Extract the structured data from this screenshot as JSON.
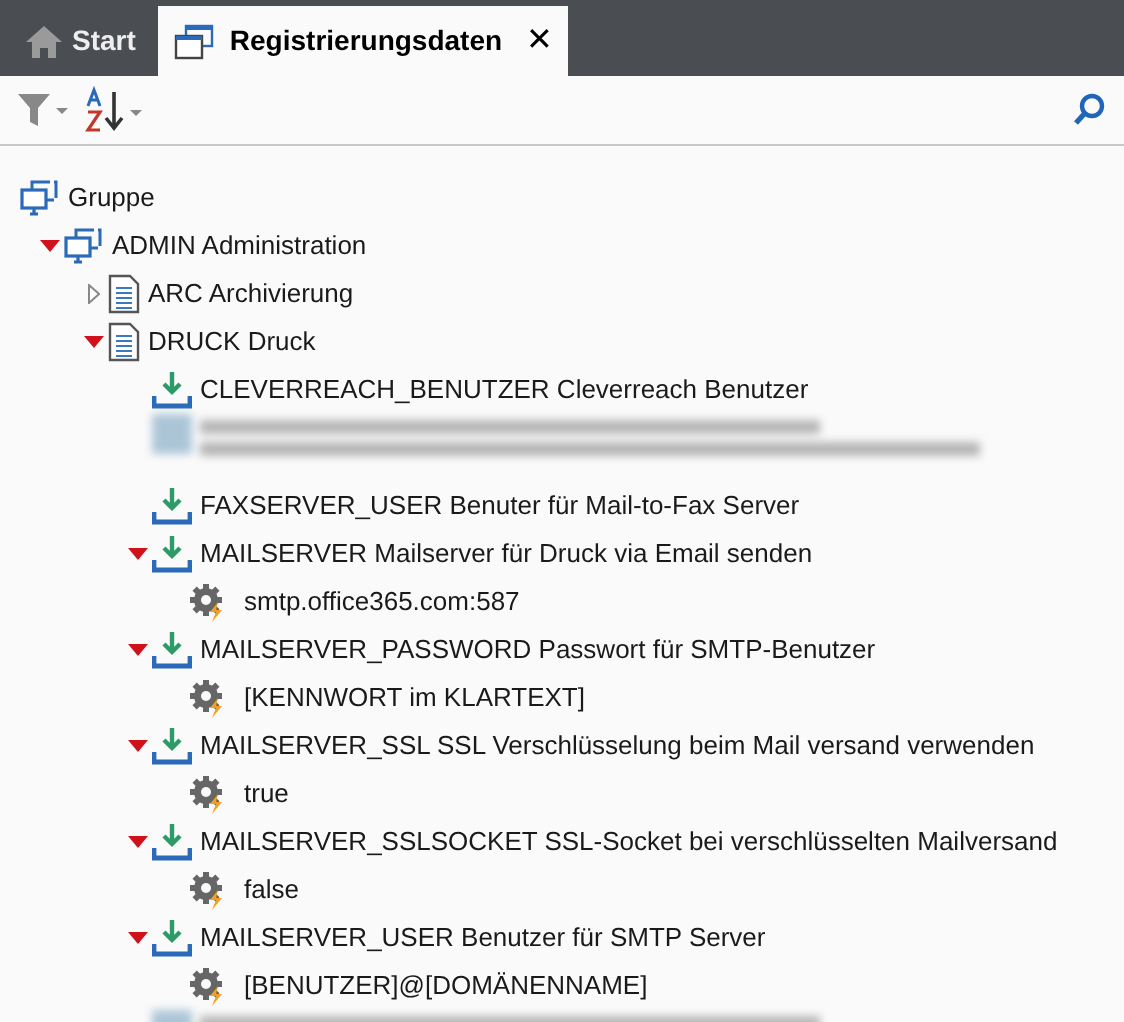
{
  "tabs": [
    {
      "kind": "home",
      "label": "Start",
      "selected": false
    },
    {
      "kind": "window",
      "label": "Registrierungsdaten",
      "selected": true,
      "close": "✕"
    }
  ],
  "tree": [
    {
      "kind": "group",
      "label": "Gruppe",
      "children": [
        {
          "kind": "group",
          "label": "ADMIN Administration",
          "expanded": true,
          "children": [
            {
              "kind": "doc",
              "label": "ARC Archivierung",
              "expanded": false
            },
            {
              "kind": "doc",
              "label": "DRUCK Druck",
              "expanded": true,
              "children": [
                {
                  "kind": "param",
                  "label": "CLEVERREACH_BENUTZER Cleverreach Benutzer"
                },
                {
                  "kind": "redacted_block"
                },
                {
                  "kind": "param",
                  "label": "FAXSERVER_USER Benuter für Mail-to-Fax Server"
                },
                {
                  "kind": "param",
                  "label": "MAILSERVER Mailserver für Druck via Email senden",
                  "expanded": true,
                  "children": [
                    {
                      "kind": "value",
                      "label": "smtp.office365.com:587"
                    }
                  ]
                },
                {
                  "kind": "param",
                  "label": "MAILSERVER_PASSWORD Passwort für SMTP-Benutzer",
                  "expanded": true,
                  "children": [
                    {
                      "kind": "value",
                      "label": "[KENNWORT im KLARTEXT]"
                    }
                  ]
                },
                {
                  "kind": "param",
                  "label": "MAILSERVER_SSL SSL Verschlüsselung beim Mail versand verwenden",
                  "expanded": true,
                  "children": [
                    {
                      "kind": "value",
                      "label": "true"
                    }
                  ]
                },
                {
                  "kind": "param",
                  "label": "MAILSERVER_SSLSOCKET SSL-Socket bei verschlüsselten Mailversand",
                  "expanded": true,
                  "children": [
                    {
                      "kind": "value",
                      "label": "false"
                    }
                  ]
                },
                {
                  "kind": "param",
                  "label": "MAILSERVER_USER Benutzer für SMTP Server",
                  "expanded": true,
                  "children": [
                    {
                      "kind": "value",
                      "label": "[BENUTZER]@[DOMÄNENNAME]"
                    }
                  ]
                },
                {
                  "kind": "redacted_line"
                }
              ]
            }
          ]
        }
      ]
    }
  ]
}
